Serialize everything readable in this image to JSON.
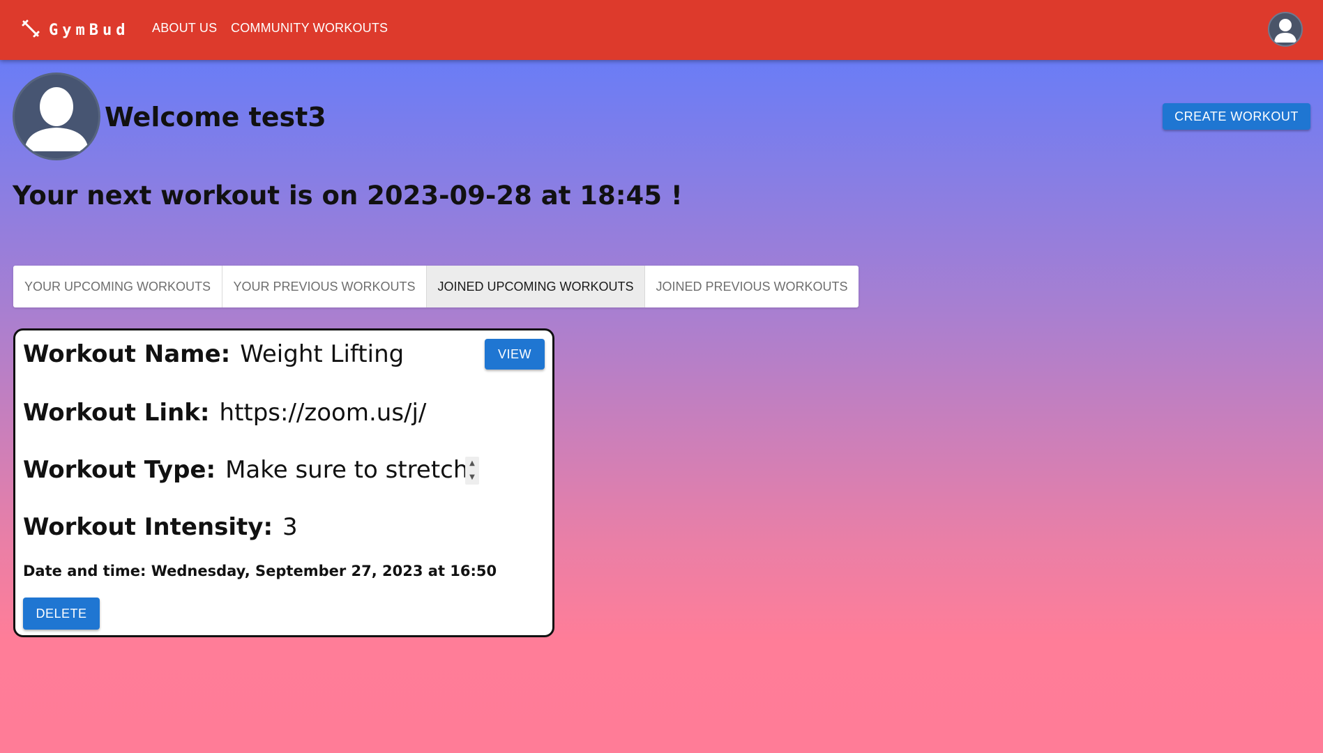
{
  "nav": {
    "brand": "GymBud",
    "links": [
      "ABOUT US",
      "COMMUNITY WORKOUTS"
    ]
  },
  "profile": {
    "welcome": "Welcome test3"
  },
  "actions": {
    "create_workout": "CREATE WORKOUT"
  },
  "next_workout": "Your next workout is on 2023-09-28 at 18:45 !",
  "tabs": [
    {
      "label": "YOUR UPCOMING WORKOUTS",
      "active": false
    },
    {
      "label": "YOUR PREVIOUS WORKOUTS",
      "active": false
    },
    {
      "label": "JOINED UPCOMING WORKOUTS",
      "active": true
    },
    {
      "label": "JOINED PREVIOUS WORKOUTS",
      "active": false
    }
  ],
  "workout_card": {
    "name_label": "Workout Name:",
    "name": "Weight Lifting",
    "view_button": "VIEW",
    "link_label": "Workout Link:",
    "link": "https://zoom.us/j/",
    "type_label": "Workout Type:",
    "type": "Make sure to stretch",
    "intensity_label": "Workout Intensity:",
    "intensity": "3",
    "datetime": "Date and time: Wednesday, September 27, 2023 at 16:50",
    "delete_button": "DELETE"
  },
  "colors": {
    "navbar": "#dd3a2c",
    "button": "#1f76d2",
    "gradient_top": "#5b7cff",
    "gradient_bottom": "#ff7c97"
  }
}
